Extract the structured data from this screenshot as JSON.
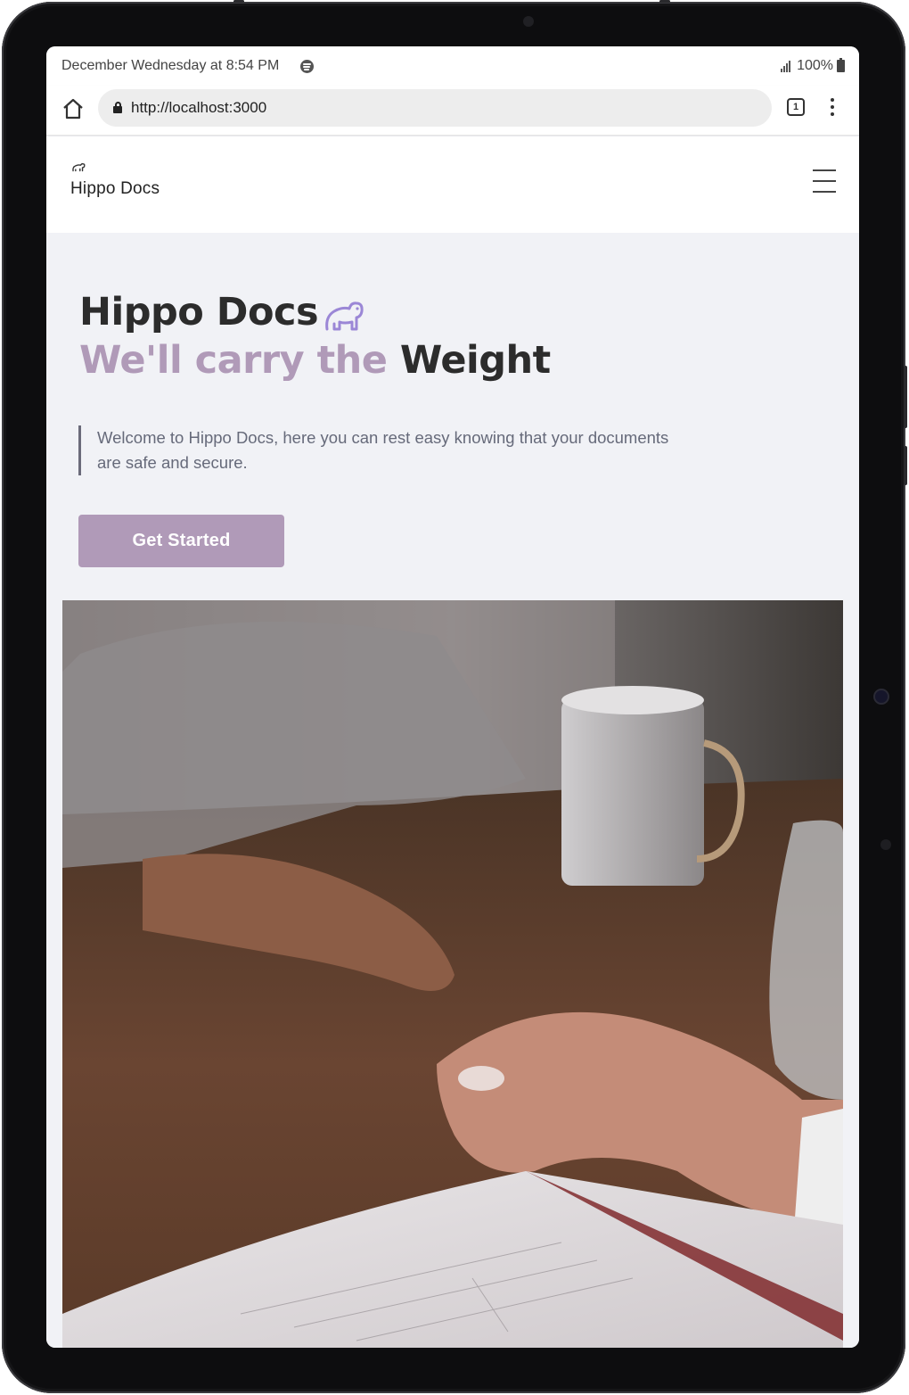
{
  "status_bar": {
    "time": "December Wednesday at 8:54 PM",
    "battery": "100%"
  },
  "browser": {
    "url": "http://localhost:3000",
    "tab_count": "1"
  },
  "nav": {
    "brand": "Hippo Docs"
  },
  "hero": {
    "title": "Hippo Docs",
    "subtitle_accent": "We'll carry the",
    "subtitle_dark": "Weight",
    "quote": "Welcome to Hippo Docs, here you can rest easy knowing that your documents are safe and secure.",
    "cta_label": "Get Started"
  },
  "colors": {
    "accent": "#b09ab8",
    "heading": "#2c2c2c",
    "background": "#f1f2f6"
  },
  "icons": [
    "spotify-icon",
    "signal-icon",
    "battery-icon",
    "home-icon",
    "lock-icon",
    "tabs-icon",
    "more-vert-icon",
    "hippo-icon",
    "hamburger-menu-icon"
  ]
}
